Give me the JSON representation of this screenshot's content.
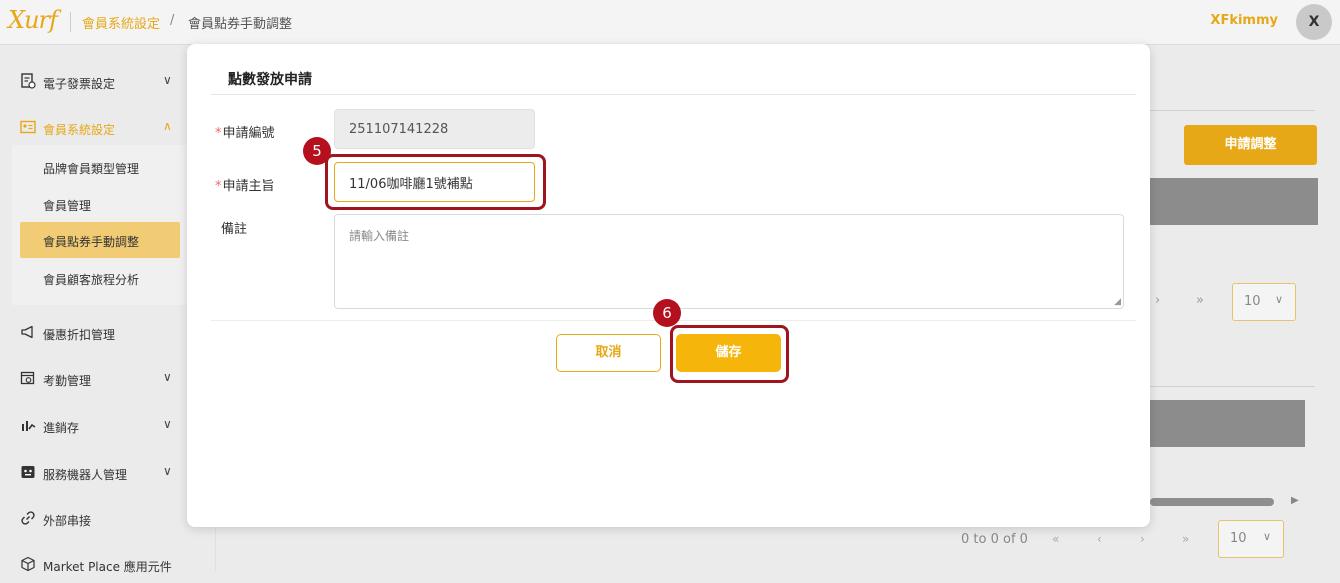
{
  "header": {
    "logo": "Xurf",
    "breadcrumb": [
      "會員系統設定",
      "/",
      "會員點券手動調整"
    ],
    "username": "XFkimmy",
    "avatar_initial": "X"
  },
  "sidebar": {
    "items": [
      {
        "label": "電子發票設定",
        "icon": "invoice-icon",
        "has_chevron": true,
        "chevron": "∨"
      },
      {
        "label": "會員系統設定",
        "icon": "member-card-icon",
        "has_chevron": true,
        "chevron": "∧",
        "active": true
      },
      {
        "label": "優惠折扣管理",
        "icon": "megaphone-icon",
        "has_chevron": false
      },
      {
        "label": "考勤管理",
        "icon": "calendar-clock-icon",
        "has_chevron": true,
        "chevron": "∨"
      },
      {
        "label": "進銷存",
        "icon": "inventory-chart-icon",
        "has_chevron": true,
        "chevron": "∨"
      },
      {
        "label": "服務機器人管理",
        "icon": "robot-icon",
        "has_chevron": true,
        "chevron": "∨"
      },
      {
        "label": "外部串接",
        "icon": "link-icon",
        "has_chevron": false
      },
      {
        "label": "Market Place 應用元件",
        "icon": "cube-icon",
        "has_chevron": false
      }
    ],
    "submenu": [
      {
        "label": "品牌會員類型管理"
      },
      {
        "label": "會員管理"
      },
      {
        "label": "會員點券手動調整",
        "active": true
      },
      {
        "label": "會員顧客旅程分析"
      }
    ]
  },
  "background": {
    "apply_button": "申請調整",
    "pager_top": {
      "next": "›",
      "last": "»",
      "page_size": "10"
    },
    "pager_bottom": {
      "summary": "0 to 0 of 0",
      "first": "«",
      "prev": "‹",
      "next": "›",
      "last": "»",
      "page_size": "10"
    }
  },
  "modal": {
    "title": "點數發放申請",
    "fields": {
      "app_no": {
        "label": "申請編號",
        "required": true,
        "value": "251107141228"
      },
      "subject": {
        "label": "申請主旨",
        "required": true,
        "value": "11/06咖啡廳1號補點"
      },
      "remark": {
        "label": "備註",
        "required": false,
        "placeholder": "請輸入備註"
      }
    },
    "cancel_label": "取消",
    "save_label": "儲存"
  },
  "annotations": [
    {
      "number": "5",
      "target": "subject-input"
    },
    {
      "number": "6",
      "target": "save-button"
    }
  ],
  "colors": {
    "accent": "#e6a817",
    "save": "#f5b50a",
    "annotation": "#a0141e"
  }
}
